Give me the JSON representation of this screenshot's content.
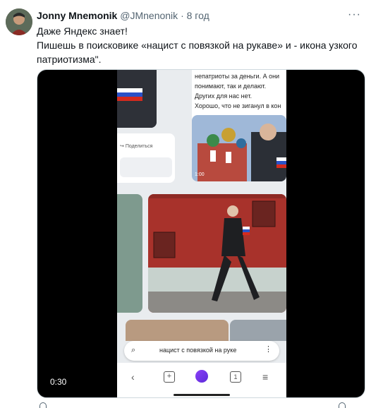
{
  "author": {
    "name": "Jonny Mnemonik",
    "handle": "@JMnenonik",
    "separator": "·",
    "time": "8 год"
  },
  "tweet": {
    "lines": [
      "Даже Яндекс знает!",
      "Пишешь в поисковике «нацист с повязкой на рукаве» и  - икона узкого",
      "патриотизма\"."
    ]
  },
  "video": {
    "duration": "0:30",
    "screen": {
      "snippet_lines": [
        "непатриоты за деньги. А они",
        "понимают, так и делают.",
        "Других для нас нет.",
        "Хорошо, что не зиганул в кон"
      ],
      "share_label": "Поделиться",
      "thumb_time": "1:00",
      "search_query": "нацист с повязкой на руке",
      "tab_count": "1"
    }
  },
  "icons": [
    "more-icon",
    "back-icon",
    "new-tab-icon",
    "alice-icon",
    "tabs-icon",
    "menu-icon"
  ]
}
